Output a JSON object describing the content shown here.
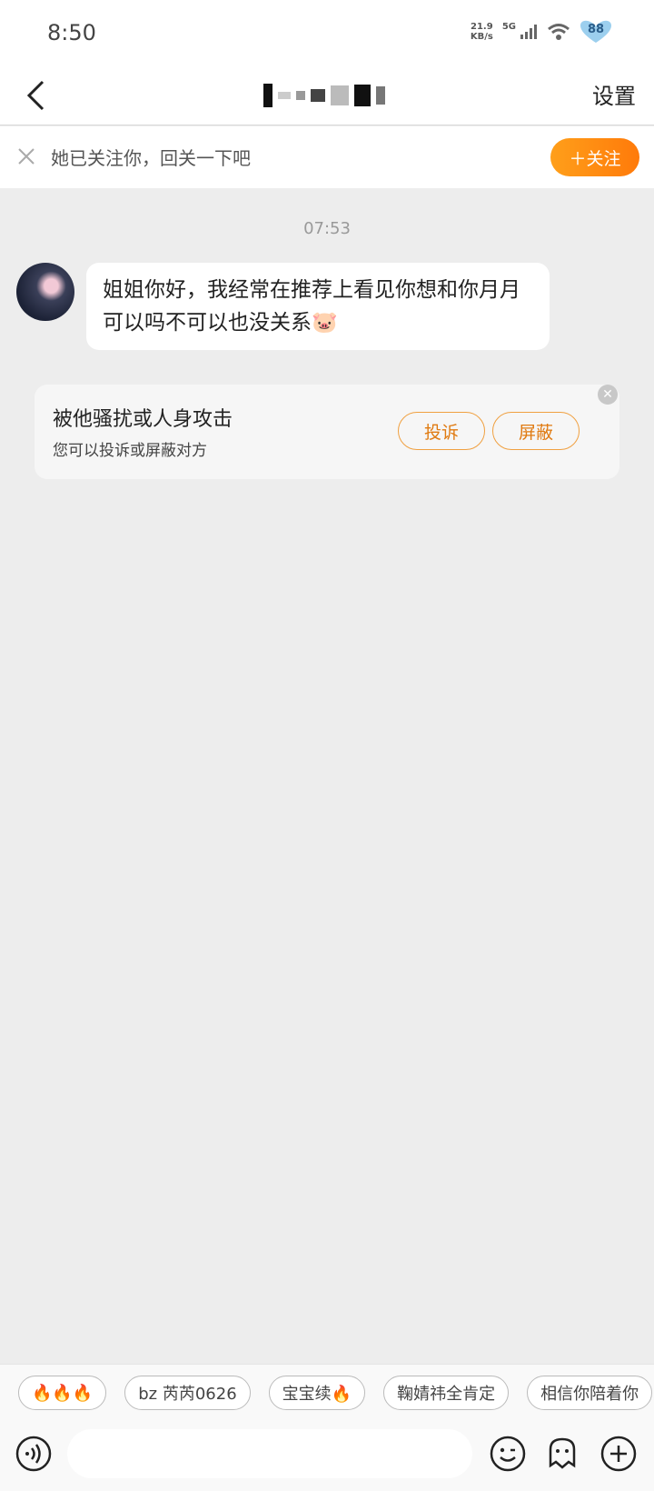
{
  "status_bar": {
    "time": "8:50",
    "net_speed_value": "21.9",
    "net_speed_unit": "KB/s",
    "network": "5G",
    "battery": "88"
  },
  "nav": {
    "settings_label": "设置"
  },
  "follow_bar": {
    "text": "她已关注你，回关一下吧",
    "button_label": "＋关注"
  },
  "chat": {
    "timestamp": "07:53",
    "message_text": "姐姐你好，我经常在推荐上看见你想和你月月可以吗不可以也没关系🐷"
  },
  "report_card": {
    "title": "被他骚扰或人身攻击",
    "subtitle": "您可以投诉或屏蔽对方",
    "complain_label": "投诉",
    "block_label": "屏蔽"
  },
  "quick_replies": [
    "🔥🔥🔥",
    "bz 芮芮0626",
    "宝宝续🔥",
    "鞠婧祎全肯定",
    "相信你陪着你"
  ],
  "colors": {
    "accent": "#ff8c12",
    "background": "#ededed"
  }
}
